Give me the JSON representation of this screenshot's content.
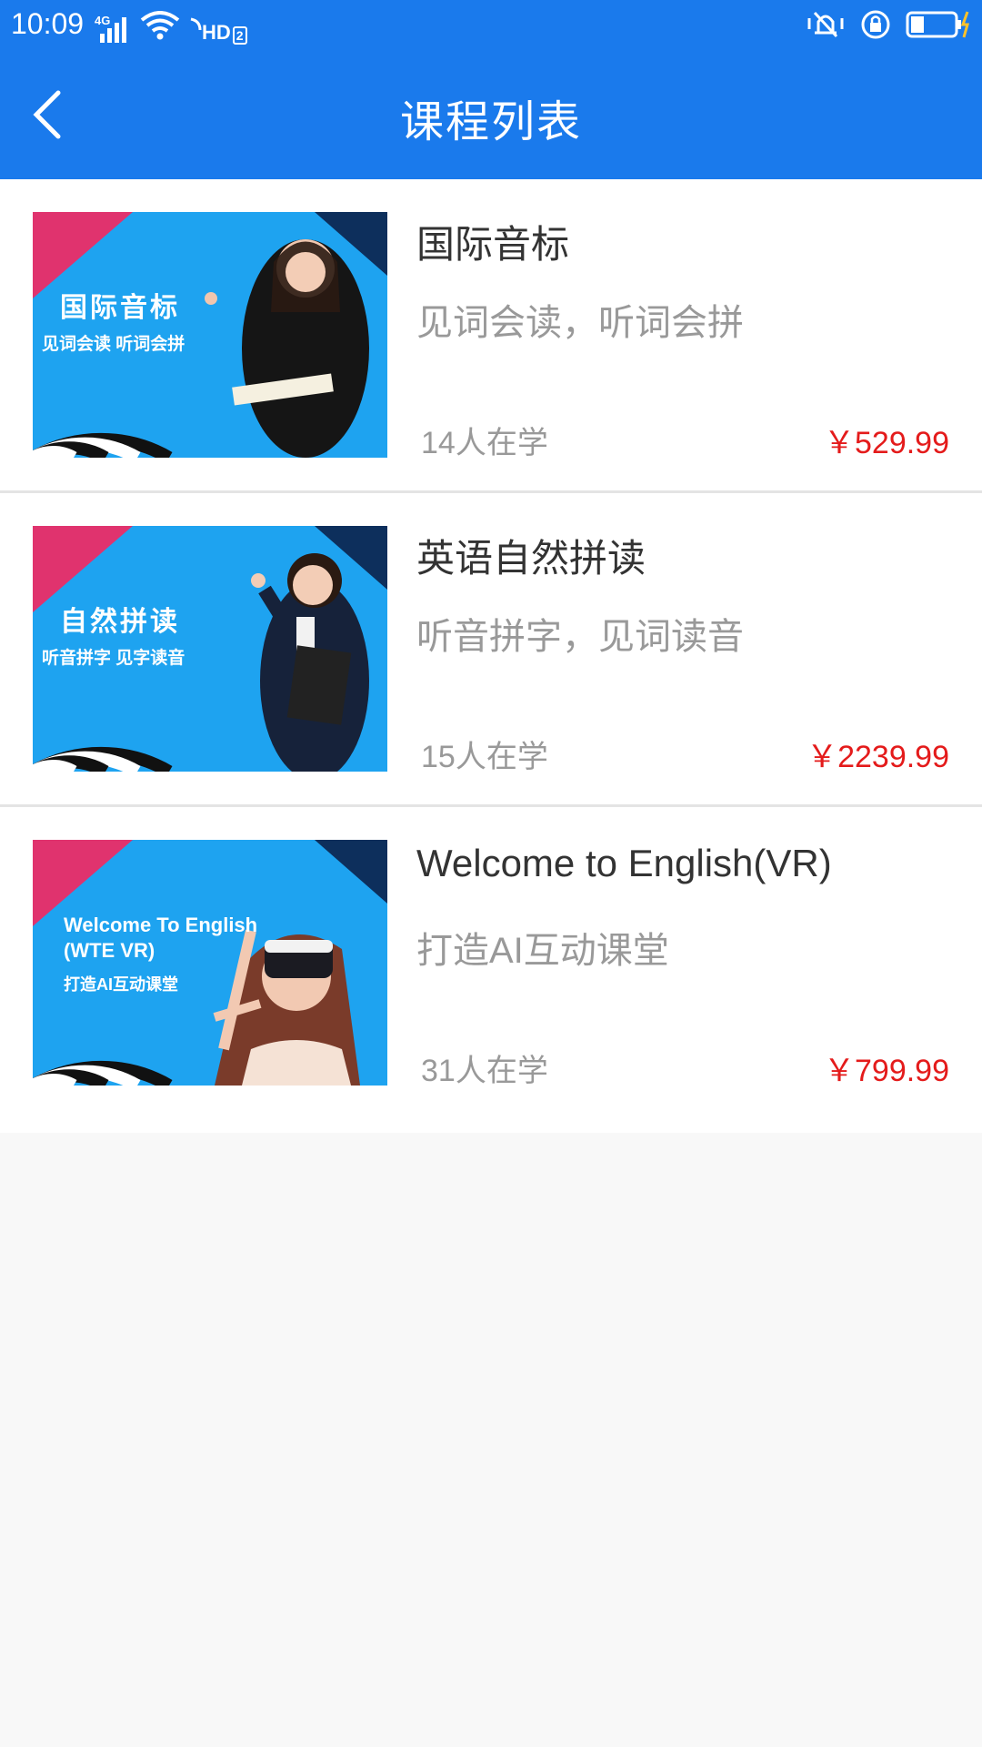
{
  "status_bar": {
    "time": "10:09",
    "network": "4G",
    "hd_label": "HD",
    "hd_num": "2"
  },
  "header": {
    "title": "课程列表"
  },
  "courses": [
    {
      "title": "国际音标",
      "subtitle": "见词会读，听词会拼",
      "learners": "14人在学",
      "price": "￥529.99",
      "thumb_title": "国际音标",
      "thumb_subtitle": "见词会读  听词会拼"
    },
    {
      "title": "英语自然拼读",
      "subtitle": "听音拼字，见词读音",
      "learners": "15人在学",
      "price": "￥2239.99",
      "thumb_title": "自然拼读",
      "thumb_subtitle": "听音拼字  见字读音"
    },
    {
      "title": "Welcome to English(VR)",
      "subtitle": "打造AI互动课堂",
      "learners": "31人在学",
      "price": "￥799.99",
      "thumb_title_line1": "Welcome To English",
      "thumb_title_line2": "(WTE  VR)",
      "thumb_subtitle": "打造AI互动课堂"
    }
  ],
  "colors": {
    "header_bg": "#1a7aec",
    "price": "#e41b1b",
    "thumb_bg": "#1ea3f0",
    "thumb_accent": "#e0336e"
  }
}
